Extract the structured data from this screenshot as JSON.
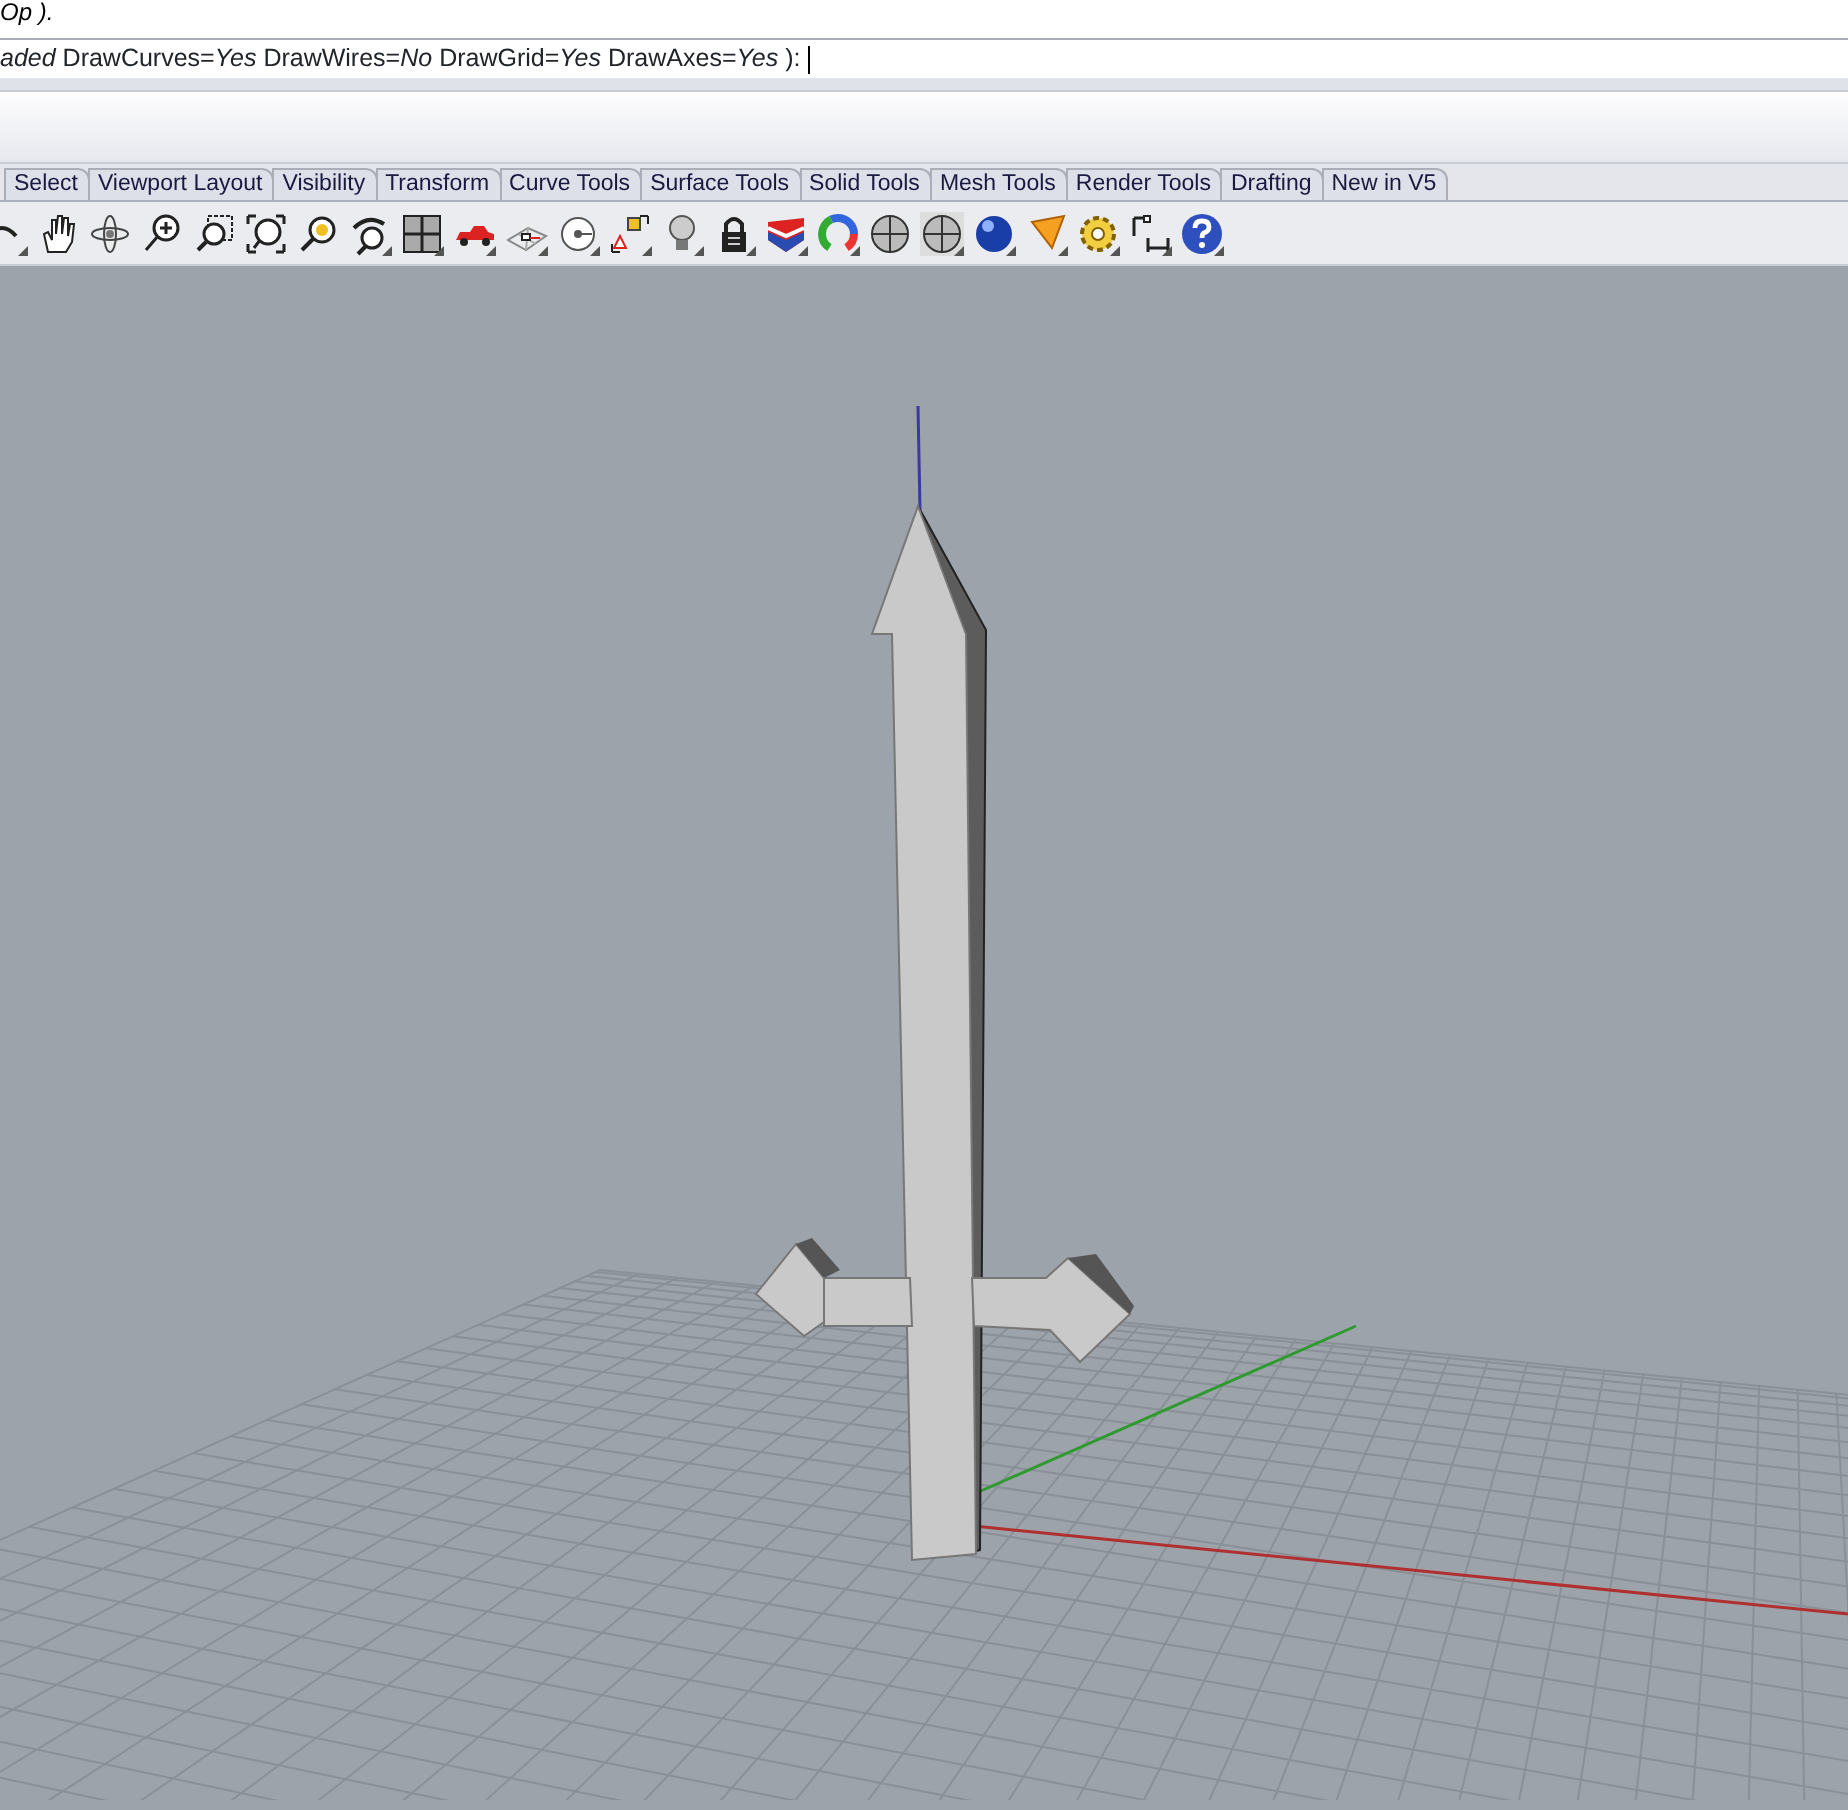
{
  "command_history": "Op ).",
  "command_prompt": "*aded* DrawCurves=*Yes* DrawWires=*No* DrawGrid=*Yes* DrawAxes=*Yes* ):",
  "toolbar_tabs": [
    {
      "label": "Select",
      "selected": false
    },
    {
      "label": "Viewport Layout",
      "selected": false
    },
    {
      "label": "Visibility",
      "selected": false
    },
    {
      "label": "Transform",
      "selected": false
    },
    {
      "label": "Curve Tools",
      "selected": false
    },
    {
      "label": "Surface Tools",
      "selected": false
    },
    {
      "label": "Solid Tools",
      "selected": false
    },
    {
      "label": "Mesh Tools",
      "selected": false
    },
    {
      "label": "Render Tools",
      "selected": false
    },
    {
      "label": "Drafting",
      "selected": false
    },
    {
      "label": "New in V5",
      "selected": false
    }
  ]
}
